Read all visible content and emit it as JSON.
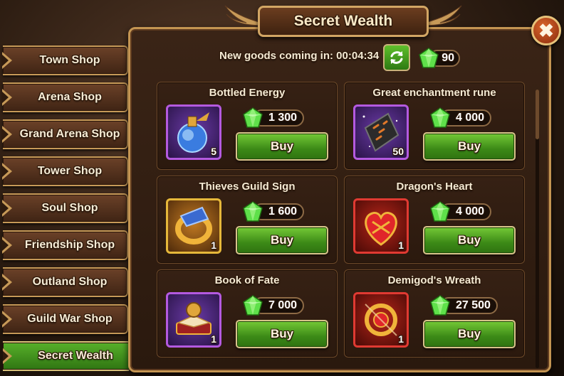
{
  "window": {
    "title": "Secret Wealth",
    "close_label": "✖"
  },
  "status": {
    "timer_label": "New goods coming in:",
    "timer_value": "00:04:34",
    "gem_balance": "90"
  },
  "sidebar": {
    "items": [
      {
        "label": "Town Shop",
        "active": false
      },
      {
        "label": "Arena Shop",
        "active": false
      },
      {
        "label": "Grand Arena Shop",
        "active": false
      },
      {
        "label": "Tower Shop",
        "active": false
      },
      {
        "label": "Soul Shop",
        "active": false
      },
      {
        "label": "Friendship Shop",
        "active": false
      },
      {
        "label": "Outland Shop",
        "active": false
      },
      {
        "label": "Guild War Shop",
        "active": false
      },
      {
        "label": "Secret Wealth",
        "active": true
      }
    ]
  },
  "shop": {
    "buy_label": "Buy",
    "items": [
      {
        "name": "Bottled Energy",
        "price": "1 300",
        "qty": "5",
        "rarity": "purple",
        "icon": "potion-icon"
      },
      {
        "name": "Great enchantment rune",
        "price": "4 000",
        "qty": "50",
        "rarity": "purple",
        "icon": "rune-icon"
      },
      {
        "name": "Thieves Guild Sign",
        "price": "1 600",
        "qty": "1",
        "rarity": "gold",
        "icon": "ring-icon"
      },
      {
        "name": "Dragon's Heart",
        "price": "4 000",
        "qty": "1",
        "rarity": "red",
        "icon": "dragon-heart-icon"
      },
      {
        "name": "Book of Fate",
        "price": "7 000",
        "qty": "1",
        "rarity": "purple",
        "icon": "book-icon"
      },
      {
        "name": "Demigod's Wreath",
        "price": "27 500",
        "qty": "1",
        "rarity": "red",
        "icon": "wreath-icon"
      }
    ]
  },
  "colors": {
    "panel_border": "#c49552",
    "buy_green": "#3c8a17",
    "active_tab": "#57b02a",
    "gem_green": "#5fe04a"
  }
}
